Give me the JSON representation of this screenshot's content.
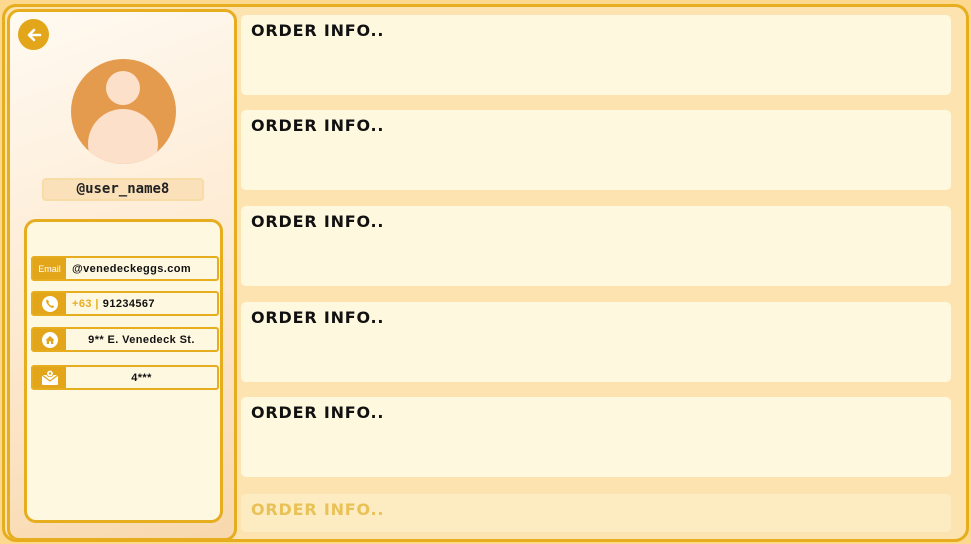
{
  "profile": {
    "username": "@user_name8",
    "contact": {
      "email_tag": "Email",
      "email": "@venedeckeggs.com",
      "phone_prefix": "+63 |",
      "phone": "91234567",
      "address": "9** E. Venedeck St.",
      "postal": "4***"
    }
  },
  "orders": [
    {
      "label": "ORDER INFO.."
    },
    {
      "label": "ORDER INFO.."
    },
    {
      "label": "ORDER INFO.."
    },
    {
      "label": "ORDER INFO.."
    },
    {
      "label": "ORDER INFO.."
    },
    {
      "label": "ORDER INFO.."
    }
  ],
  "colors": {
    "accent": "#e6ad1f",
    "avatar": "#e49b4d",
    "card": "#fef8de",
    "background": "#fde3b0"
  },
  "icons": [
    "back-arrow-icon",
    "user-avatar-icon",
    "phone-icon",
    "home-icon",
    "mail-icon"
  ]
}
